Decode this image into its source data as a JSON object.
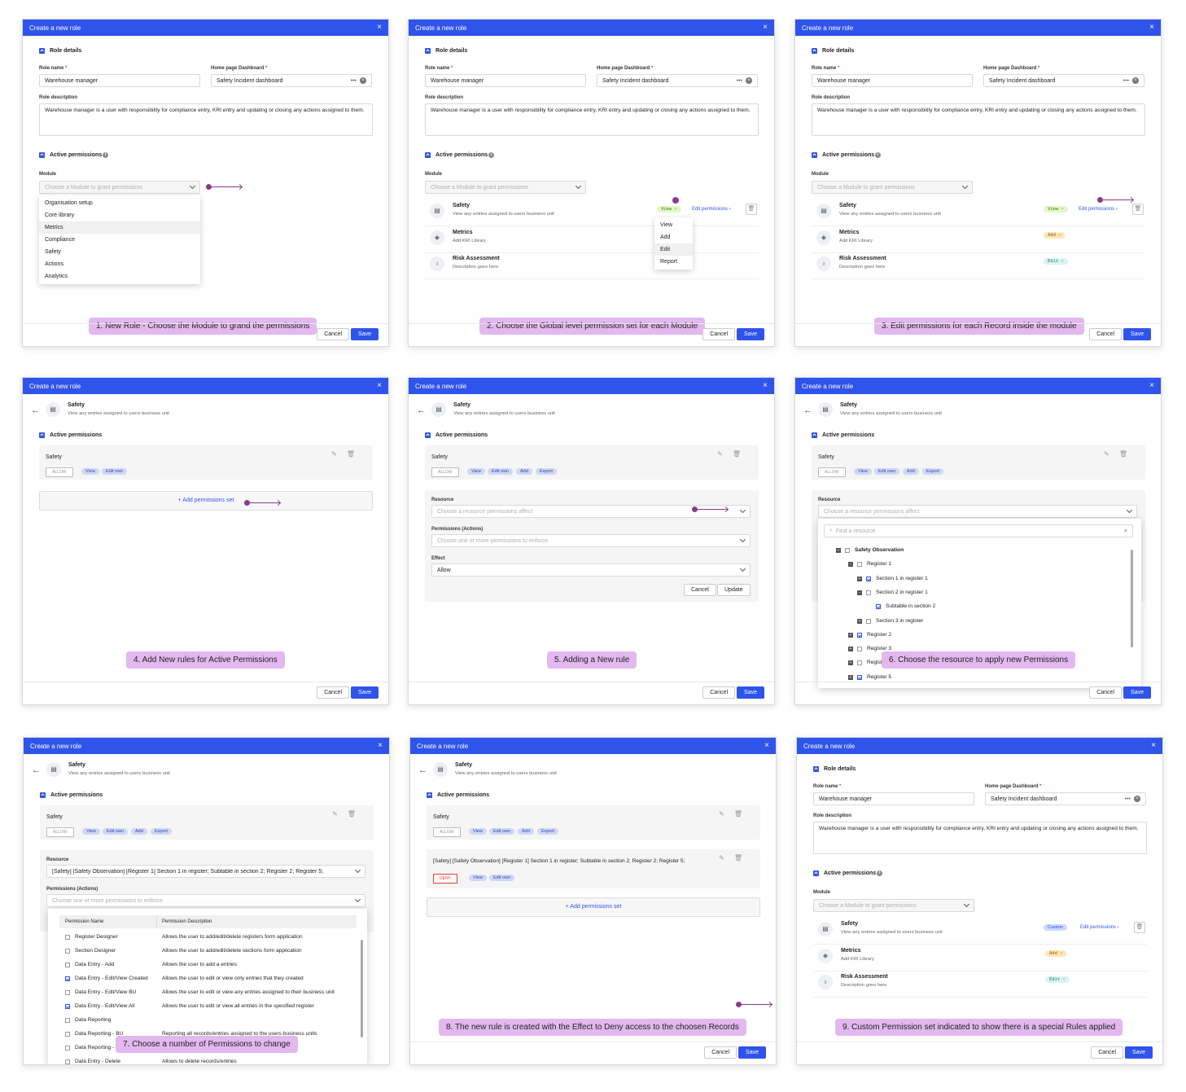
{
  "window_title": "Create a new role",
  "close_glyph": "×",
  "common": {
    "role_details": "Role details",
    "role_name_label": "Role name",
    "home_label": "Home page Dashboard",
    "required": "*",
    "role_name_value": "Warehouse manager",
    "home_value": "Safety Incident dashboard",
    "more_glyph": "•••",
    "desc_label": "Role description",
    "desc_value": "Warehouse manager is a user with responsibility for compliance entry, KRI entry and updating or closing any actions assigned to them.",
    "active_permissions": "Active permissions",
    "module_label": "Module",
    "module_placeholder": "Choose a Module to grant permissions",
    "cancel": "Cancel",
    "save": "Save",
    "update": "Update",
    "edit_permissions": "Edit permissions",
    "add_permissions_set": "+ Add permissions set",
    "info_glyph": "i"
  },
  "modules": [
    {
      "name": "Safety",
      "desc": "View any entries assigned to users business unit"
    },
    {
      "name": "Metrics",
      "desc": "Add KRI Library"
    },
    {
      "name": "Risk Assessment",
      "desc": "Description goes here"
    }
  ],
  "module_menu": [
    "Organisation setup",
    "Core library",
    "Metrics",
    "Compliance",
    "Safety",
    "Actions",
    "Analytics"
  ],
  "level_menu": [
    "View",
    "Add",
    "Edit",
    "Report"
  ],
  "pills": {
    "view": "View",
    "add": "Add",
    "edit": "Edit",
    "custom": "Custom"
  },
  "safety_card": {
    "title": "Safety",
    "allow": "ALLOW",
    "deny": "DENY",
    "chips": [
      "View",
      "Edit own",
      "Add",
      "Export"
    ]
  },
  "rule_form": {
    "resource_label": "Resource",
    "resource_placeholder": "Choose a resource permissions affect",
    "actions_label": "Permissions (Actions)",
    "actions_placeholder": "Choose one or more permissions to enforce",
    "effect_label": "Effect",
    "effect_value": "Allow",
    "find_placeholder": "Find a resource",
    "resource_value": "[Safety] [Safety Observation] [Register 1] Section 1 in register; Subtable in section 2; Register 2; Register 5;",
    "new_rule_title": "[Safety] [Safety Observation] [Register 1] Section 1 in register; Subtable in section 2; Register 2; Register 5;"
  },
  "tree": [
    "Safety Observation",
    "Register 1",
    "Section 1 in register 1",
    "Section 2 in register 1",
    "Subtable in section 2",
    "Section 3 in register",
    "Register 2",
    "Register 3",
    "Register 4",
    "Register 5"
  ],
  "perm_table": {
    "head_name": "Permission Name",
    "head_desc": "Permission Description",
    "rows": [
      {
        "name": "Register Designer",
        "desc": "Allows the user to add/edit/delete registers form application",
        "on": false
      },
      {
        "name": "Section Designer",
        "desc": "Allows the user to add/edit/delete sections form application",
        "on": false
      },
      {
        "name": "Data Entry - Add",
        "desc": "Allows the user to add a entries",
        "on": false
      },
      {
        "name": "Data Entry - Edit/View Created",
        "desc": "Allows the user to edit or view only entries that they created",
        "on": true
      },
      {
        "name": "Data Entry - Edit/View BU",
        "desc": "Allows the user to edit or view any entries assigned to their business unit",
        "on": false
      },
      {
        "name": "Data Entry - Edit/View All",
        "desc": "Allows the user to edit or view all entries in the specified register",
        "on": true
      },
      {
        "name": "Data Reporting",
        "desc": "",
        "on": false
      },
      {
        "name": "Data Reporting - BU",
        "desc": "Reporting all records/entries assigned to the users business units",
        "on": false
      },
      {
        "name": "Data Reporting - All",
        "desc": "Reporting all records/entries",
        "on": false
      },
      {
        "name": "Data Entry - Delete",
        "desc": "Allows to delete records/entries",
        "on": false
      }
    ]
  },
  "captions": [
    "1. New Role - Choose the Module to grand the permissions",
    "2. Choose the Global level permission set for each Module",
    "3. Edit permissions for each Record inside the module",
    "4. Add New rules for Active Permissions",
    "5. Adding a New rule",
    "6. Choose the resource  to apply new Permissions",
    "7. Choose a number of Permissions to change",
    "8. The new rule is created with the Effect to Deny access to the choosen Records",
    "9. Custom Permission set indicated to show there is a special Rules applied"
  ]
}
